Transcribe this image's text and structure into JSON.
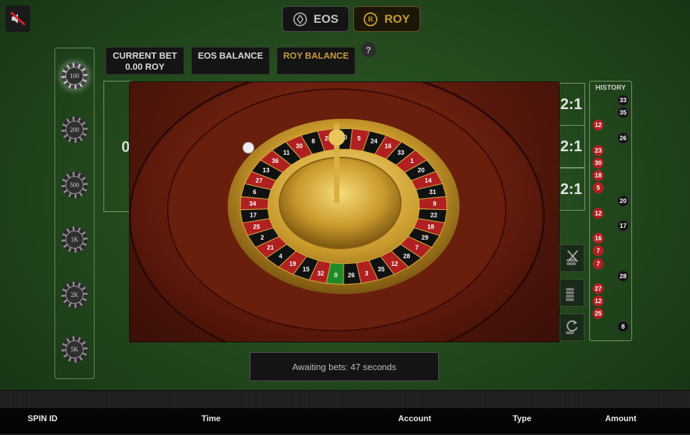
{
  "header": {
    "mute_icon": "speaker-muted-icon",
    "currencies": [
      {
        "label": "EOS",
        "icon": "eos-coin-icon",
        "color": "#c6c6c6"
      },
      {
        "label": "ROY",
        "icon": "roy-coin-icon",
        "icon_letter": "R",
        "color": "#c79a30"
      }
    ]
  },
  "info": {
    "current_bet_label": "CURRENT BET",
    "current_bet_value": "0.00 ROY",
    "eos_balance_label": "EOS BALANCE",
    "roy_balance_label": "ROY BALANCE",
    "help_label": "?"
  },
  "chips": [
    "100",
    "200",
    "500",
    "1K",
    "2K",
    "5K"
  ],
  "selected_chip": "100",
  "table": {
    "zero_label": "0",
    "column_bets": [
      "2:1",
      "2:1",
      "2:1"
    ]
  },
  "tools": [
    "clear-bets-icon",
    "double-bet-icon",
    "rebet-icon"
  ],
  "history": {
    "title": "HISTORY",
    "results": [
      {
        "n": "33",
        "color": "black"
      },
      {
        "n": "35",
        "color": "black"
      },
      {
        "n": "12",
        "color": "red"
      },
      {
        "n": "26",
        "color": "black"
      },
      {
        "n": "23",
        "color": "red"
      },
      {
        "n": "30",
        "color": "red"
      },
      {
        "n": "18",
        "color": "red"
      },
      {
        "n": "5",
        "color": "red"
      },
      {
        "n": "20",
        "color": "black"
      },
      {
        "n": "12",
        "color": "red"
      },
      {
        "n": "17",
        "color": "black"
      },
      {
        "n": "16",
        "color": "red"
      },
      {
        "n": "7",
        "color": "red"
      },
      {
        "n": "7",
        "color": "red"
      },
      {
        "n": "28",
        "color": "black"
      },
      {
        "n": "27",
        "color": "red"
      },
      {
        "n": "12",
        "color": "red"
      },
      {
        "n": "25",
        "color": "red"
      },
      {
        "n": "8",
        "color": "black"
      }
    ]
  },
  "wheel": {
    "numbers": [
      "0",
      "32",
      "15",
      "19",
      "4",
      "21",
      "2",
      "25",
      "17",
      "34",
      "6",
      "27",
      "13",
      "36",
      "11",
      "30",
      "8",
      "23",
      "10",
      "5",
      "24",
      "16",
      "33",
      "1",
      "20",
      "14",
      "31",
      "9",
      "22",
      "18",
      "29",
      "7",
      "28",
      "12",
      "35",
      "3",
      "26"
    ]
  },
  "status": {
    "text": "Awaiting bets: 47 seconds"
  },
  "footer": {
    "columns": [
      "SPIN ID",
      "Time",
      "Account",
      "Type",
      "Amount"
    ]
  },
  "colors": {
    "felt": "#244a1e",
    "gold": "#c79a30",
    "red_pocket": "#b02020",
    "black_pocket": "#111111",
    "zero_pocket": "#1f8a2a"
  }
}
